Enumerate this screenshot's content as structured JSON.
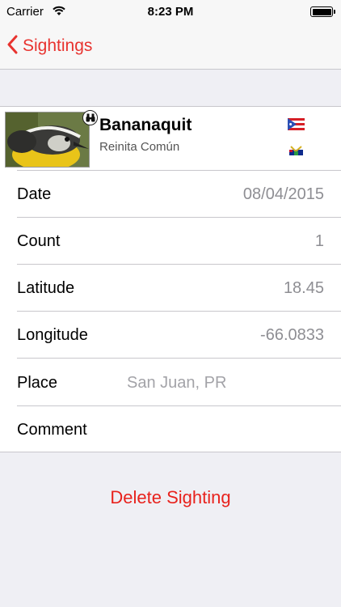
{
  "status_bar": {
    "carrier": "Carrier",
    "time": "8:23 PM"
  },
  "nav": {
    "back_label": "Sightings"
  },
  "bird": {
    "name": "Bananaquit",
    "spanish_name": "Reinita Común"
  },
  "fields": [
    {
      "label": "Date",
      "value": "08/04/2015"
    },
    {
      "label": "Count",
      "value": "1"
    },
    {
      "label": "Latitude",
      "value": "18.45"
    },
    {
      "label": "Longitude",
      "value": "-66.0833"
    },
    {
      "label": "Place",
      "value": "San Juan, PR"
    },
    {
      "label": "Comment",
      "value": ""
    }
  ],
  "actions": {
    "delete_label": "Delete Sighting"
  },
  "colors": {
    "accent": "#e8332f",
    "background": "#efeff4",
    "secondary_text": "#8e8e93"
  },
  "icons": [
    "wifi-icon",
    "battery-icon",
    "chevron-left-icon",
    "binoculars-icon",
    "puerto-rico-flag-icon",
    "virgin-islands-flag-icon"
  ]
}
